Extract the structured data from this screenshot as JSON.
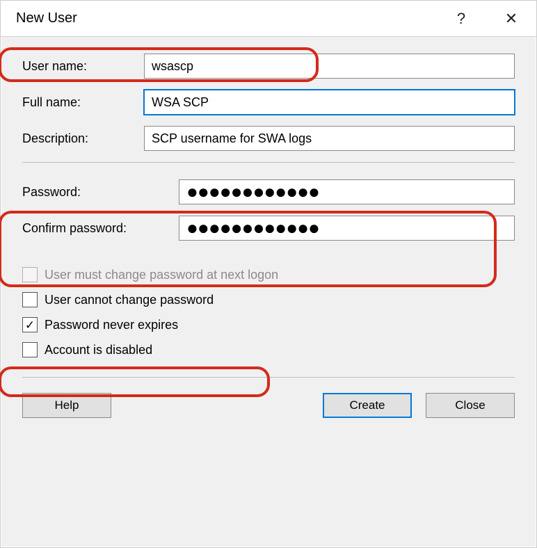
{
  "titlebar": {
    "title": "New User",
    "help_tooltip": "?",
    "close_tooltip": "✕"
  },
  "labels": {
    "user_name": "User name:",
    "full_name": "Full name:",
    "description": "Description:",
    "password": "Password:",
    "confirm_password": "Confirm password:"
  },
  "values": {
    "user_name": "wsascp",
    "full_name": "WSA SCP ",
    "description": "SCP username for SWA logs",
    "password_mask": "●●●●●●●●●●●●",
    "confirm_password_mask": "●●●●●●●●●●●●"
  },
  "checkboxes": {
    "must_change": {
      "label": "User must change password at next logon",
      "checked": false,
      "disabled": true
    },
    "cannot_change": {
      "label": "User cannot change password",
      "checked": false,
      "disabled": false
    },
    "never_expires": {
      "label": "Password never expires",
      "checked": true,
      "disabled": false
    },
    "disabled_acct": {
      "label": "Account is disabled",
      "checked": false,
      "disabled": false
    }
  },
  "buttons": {
    "help": "Help",
    "create": "Create",
    "close": "Close"
  }
}
